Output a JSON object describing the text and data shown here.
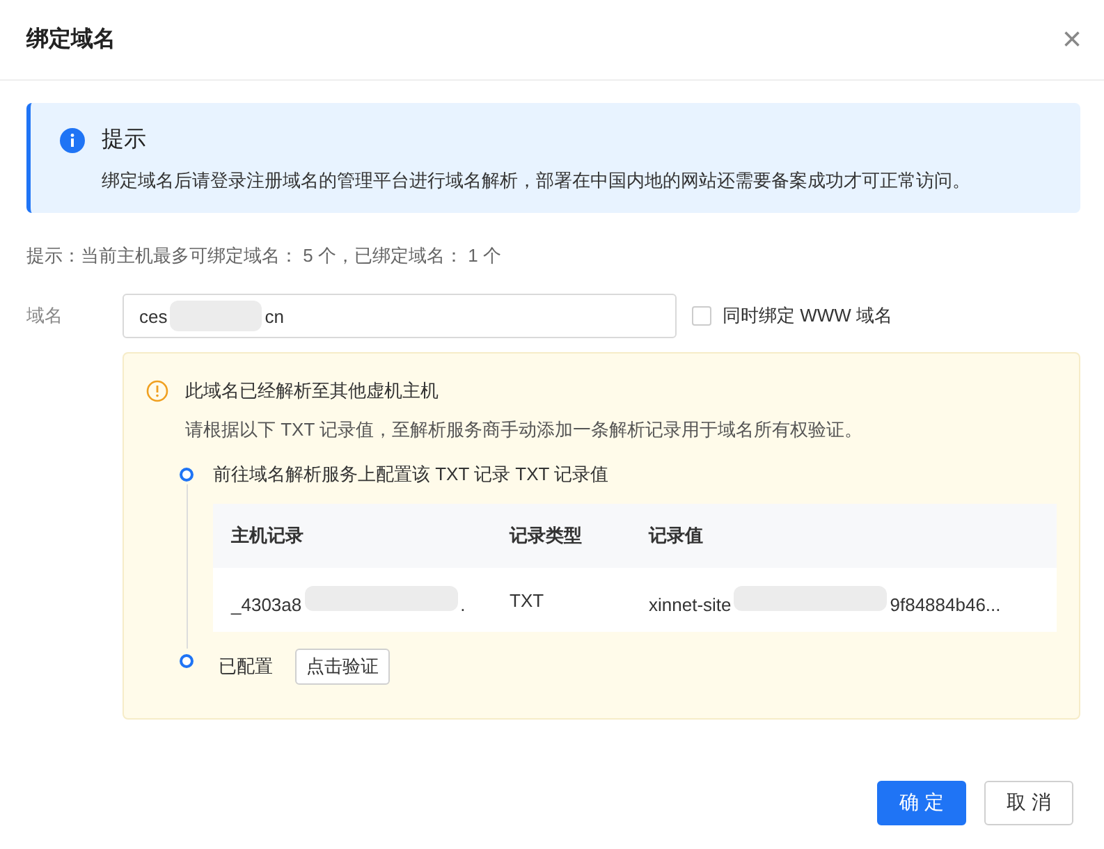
{
  "dialog": {
    "title": "绑定域名",
    "close": "×"
  },
  "alert": {
    "title": "提示",
    "text": "绑定域名后请登录注册域名的管理平台进行域名解析，部署在中国内地的网站还需要备案成功才可正常访问。"
  },
  "quota_tip": "提示：当前主机最多可绑定域名： 5 个，已绑定域名： 1 个",
  "form": {
    "label": "域名",
    "value_parts": [
      "ces",
      "cn"
    ],
    "www_checkbox": {
      "label": "同时绑定 WWW 域名",
      "checked": false
    }
  },
  "warning": {
    "title": "此域名已经解析至其他虚机主机",
    "text": "请根据以下 TXT 记录值，至解析服务商手动添加一条解析记录用于域名所有权验证。",
    "steps": [
      {
        "kind": "table",
        "text": "前往域名解析服务上配置该 TXT 记录 TXT 记录值"
      },
      {
        "kind": "verify",
        "text": "已配置",
        "button": "点击验证"
      }
    ],
    "table": {
      "columns": [
        "主机记录",
        "记录类型",
        "记录值"
      ],
      "rows": [
        [
          [
            "_4303a8",
            "."
          ],
          [
            "TXT"
          ],
          [
            "xinnet-site",
            "9f84884b46..."
          ]
        ]
      ]
    }
  },
  "buttons": [
    {
      "label": "确 定",
      "kind": "primary"
    },
    {
      "label": "取 消",
      "kind": "default"
    }
  ]
}
